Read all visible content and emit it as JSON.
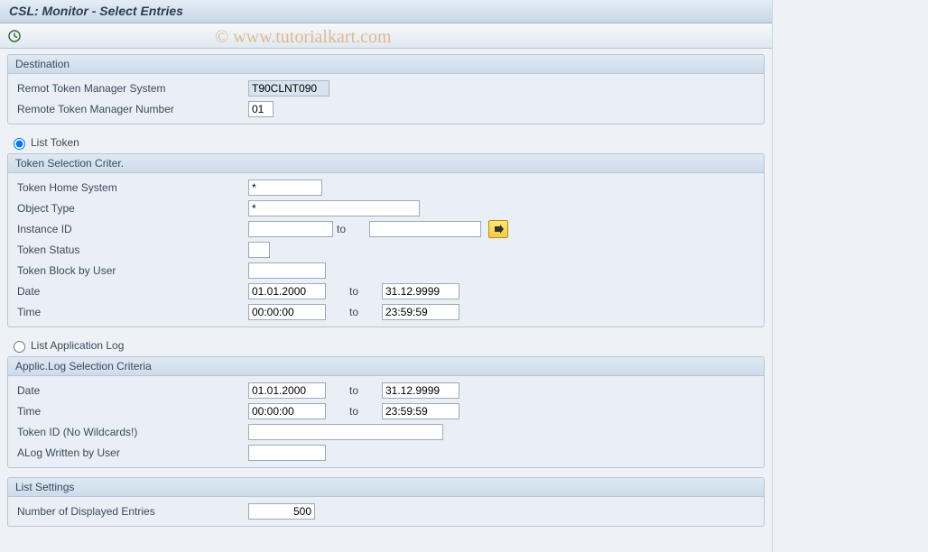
{
  "title": "CSL: Monitor - Select Entries",
  "watermark": "© www.tutorialkart.com",
  "destination": {
    "header": "Destination",
    "system_label": "Remot Token Manager System",
    "system_value": "T90CLNT090",
    "number_label": "Remote Token Manager Number",
    "number_value": "01"
  },
  "radio_list_token": "List Token",
  "token_criteria": {
    "header": "Token Selection Criter.",
    "home_system_label": "Token Home System",
    "home_system_value": "*",
    "object_type_label": "Object Type",
    "object_type_value": "*",
    "instance_id_label": "Instance ID",
    "instance_id_from": "",
    "instance_id_to": "",
    "to_label": "to",
    "token_status_label": "Token Status",
    "token_status_value": "",
    "block_user_label": "Token Block by User",
    "block_user_value": "",
    "date_label": "Date",
    "date_from": "01.01.2000",
    "date_to": "31.12.9999",
    "time_label": "Time",
    "time_from": "00:00:00",
    "time_to": "23:59:59"
  },
  "radio_list_applog": "List Application Log",
  "applog_criteria": {
    "header": "Applic.Log Selection Criteria",
    "date_label": "Date",
    "date_from": "01.01.2000",
    "date_to": "31.12.9999",
    "to_label": "to",
    "time_label": "Time",
    "time_from": "00:00:00",
    "time_to": "23:59:59",
    "token_id_label": "Token ID (No Wildcards!)",
    "token_id_value": "",
    "alog_user_label": "ALog Written by User",
    "alog_user_value": ""
  },
  "list_settings": {
    "header": "List Settings",
    "num_entries_label": "Number of Displayed Entries",
    "num_entries_value": "500"
  }
}
